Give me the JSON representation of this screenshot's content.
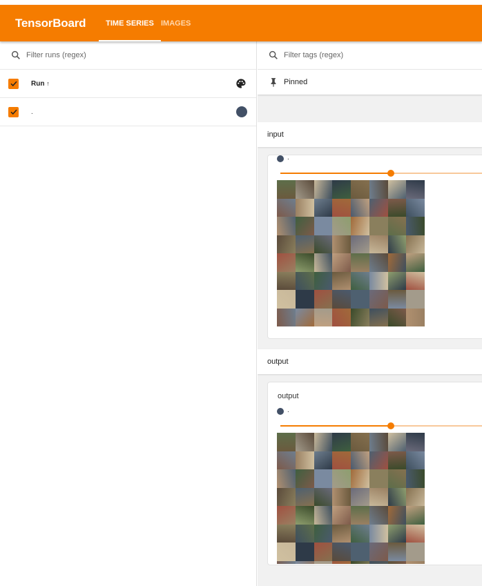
{
  "app": {
    "title": "TensorBoard",
    "tabs": [
      {
        "label": "TIME SERIES",
        "active": true
      },
      {
        "label": "IMAGES",
        "active": false
      }
    ],
    "accent_color": "#f57c00"
  },
  "sidebar": {
    "search_placeholder": "Filter runs (regex)",
    "header_label": "Run",
    "sort_glyph": "↑",
    "runs": [
      {
        "label": ".",
        "checked": true,
        "color": "#425066"
      }
    ]
  },
  "main": {
    "search_placeholder": "Filter tags (regex)",
    "pinned_label": "Pinned",
    "groups": [
      {
        "name": "input",
        "card": {
          "title": "",
          "run_label": ".",
          "step_fraction": 0.5
        }
      },
      {
        "name": "output",
        "card": {
          "title": "output",
          "run_label": ".",
          "step_fraction": 0.5
        }
      }
    ]
  },
  "icons": [
    "search-icon",
    "palette-icon",
    "pin-icon",
    "check-icon"
  ]
}
